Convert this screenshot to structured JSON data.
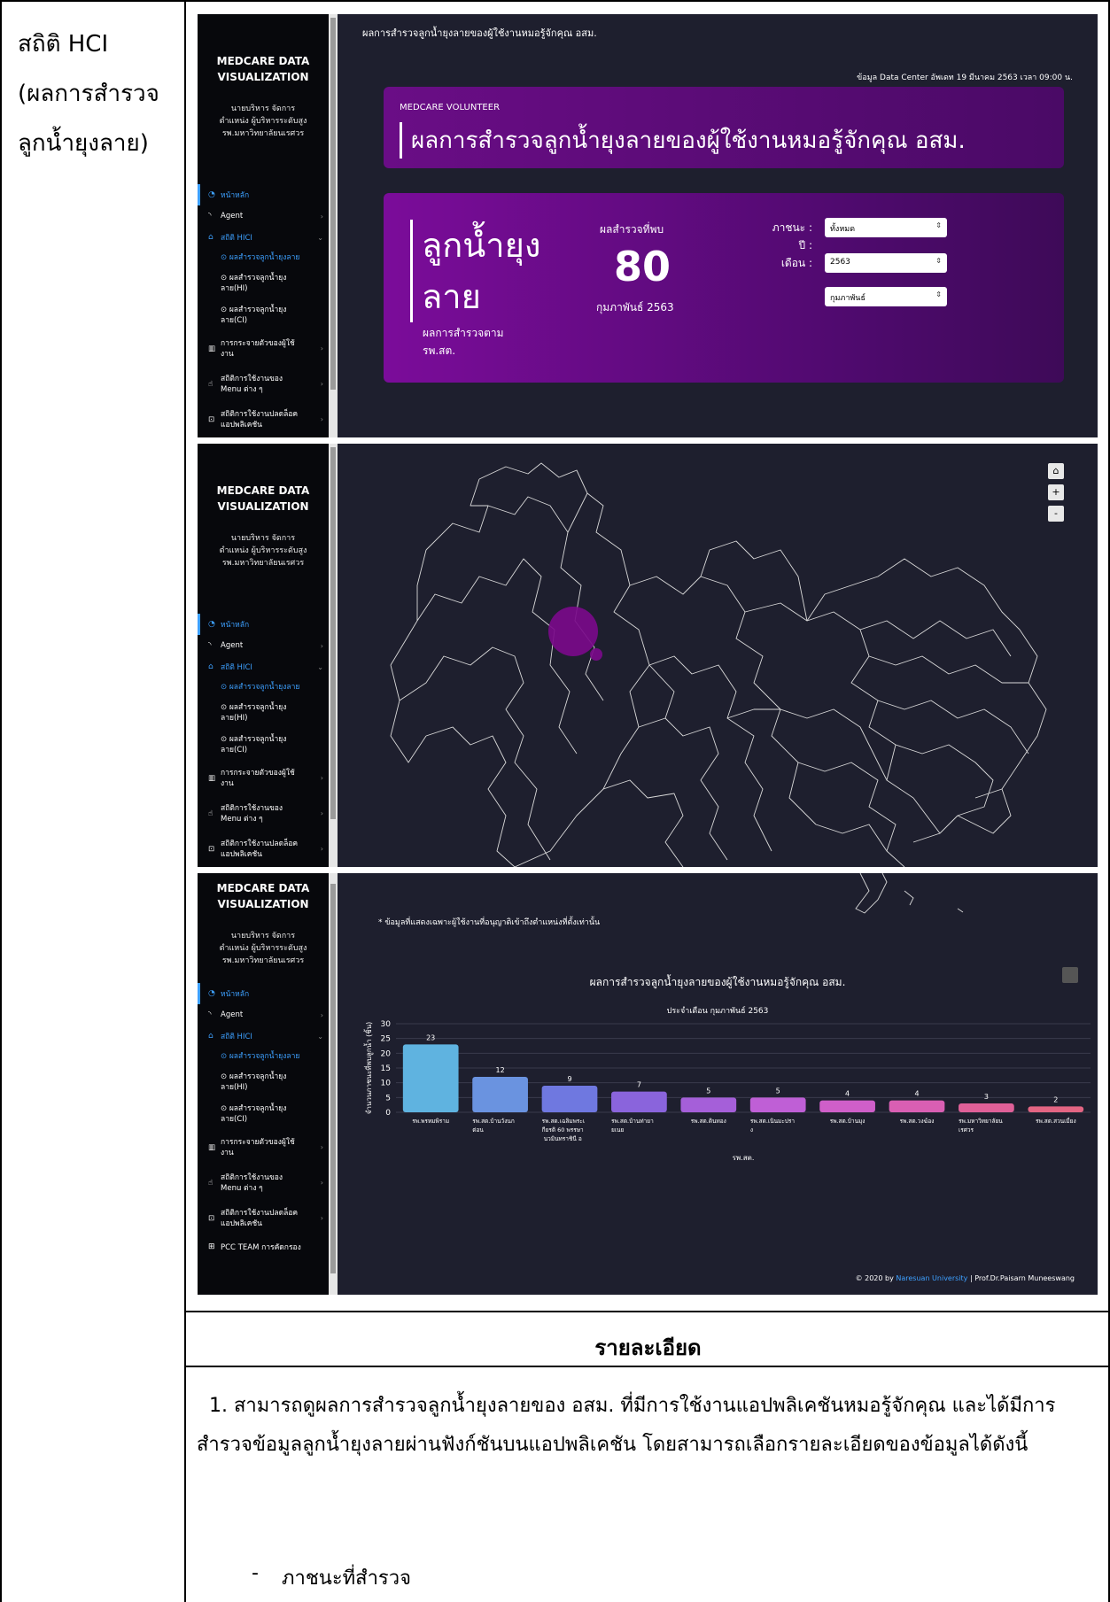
{
  "doc": {
    "row_label_line1": "สถิติ HCI",
    "row_label_line2": "(ผลการสำรวจ",
    "row_label_line3": "ลูกน้ำยุงลาย)",
    "detail_heading": "รายละเอียด",
    "detail_paragraph": "1. สามารถดูผลการสำรวจลูกน้ำยุงลายของ อสม. ที่มีการใช้งานแอปพลิเคชันหมอรู้จักคุณ และได้มีการสำรวจข้อมูลลูกน้ำยุงลายผ่านฟังก์ชันบนแอปพลิเคชัน โดยสามารถเลือกรายละเอียดของข้อมูลได้ดังนี้",
    "list_dash": "-",
    "list_item_1": "ภาชนะที่สำรวจ"
  },
  "sidebar": {
    "brand_line1": "MEDCARE DATA",
    "brand_line2": "VISUALIZATION",
    "user_line1": "นายบริหาร จัดการ",
    "user_line2": "ตำแหน่ง ผู้บริหารระดับสูง",
    "user_line3": "รพ.มหาวิทยาลัยนเรศวร",
    "home": "หน้าหลัก",
    "agent": "Agent",
    "hci": "สถิติ HICI",
    "sub1": "⊙ ผลสำรวจลูกน้ำยุงลาย",
    "sub2a": "⊙ ผลสำรวจลูกน้ำยุง",
    "sub2b": "ลาย(HI)",
    "sub3a": "⊙ ผลสำรวจลูกน้ำยุง",
    "sub3b": "ลาย(CI)",
    "dist_a": "การกระจายตัวของผู้ใช้",
    "dist_b": "งาน",
    "menu_a": "สถิติการใช้งานของ",
    "menu_b": "Menu ต่าง ๆ",
    "unlock_a": "สถิติการใช้งานปลดล็อค",
    "unlock_b": "แอปพลิเคชัน",
    "pcc": "PCC TEAM การคัดกรอง"
  },
  "panel1": {
    "top_title": "ผลการสำรวจลูกน้ำยุงลายของผู้ใช้งานหมอรู้จักคุณ อสม.",
    "data_source": "ข้อมูล Data Center อัพเดท 19 มีนาคม 2563 เวลา 09:00 น.",
    "kicker": "MEDCARE VOLUNTEER",
    "banner_title": "ผลการสำรวจลูกน้ำยุงลายของผู้ใช้งานหมอรู้จักคุณ อสม.",
    "big_title_1": "ลูกน้ำยุง",
    "big_title_2": "ลาย",
    "subtitle_1": "ผลการสำรวจตาม",
    "subtitle_2": "รพ.สต.",
    "stat_label": "ผลสำรวจที่พบ",
    "stat_value": "80",
    "stat_date": "กุมภาพันธ์ 2563",
    "filter_container_label": "ภาชนะ :",
    "filter_year_label": "ปี :",
    "filter_month_label": "เดือน :",
    "filter_container_value": "ทั้งหมด",
    "filter_year_value": "2563",
    "filter_month_value": "กุมภาพันธ์",
    "select_arrow": "⇕"
  },
  "panel2": {
    "home_btn": "⌂",
    "zoom_in": "+",
    "zoom_out": "-"
  },
  "panel3": {
    "note": "* ข้อมูลที่แสดงเฉพาะผู้ใช้งานที่อนุญาติเข้าถึงตำแหน่งที่ตั้งเท่านั้น",
    "footer_prefix": "© 2020 by",
    "footer_org": "Naresuan University",
    "footer_suffix": "| Prof.Dr.Paisarn Muneeswang"
  },
  "chart_data": {
    "type": "bar",
    "title": "ผลการสำรวจลูกน้ำยุงลายของผู้ใช้งานหมอรู้จักคุณ อสม.",
    "subtitle": "ประจำเดือน กุมภาพันธ์ 2563",
    "xlabel": "รพ.สต.",
    "ylabel": "จำนวนภาชนะที่พบลูกน้ำ (ชิ้น)",
    "ylim": [
      0,
      30
    ],
    "yticks": [
      0,
      5,
      10,
      15,
      20,
      25,
      30
    ],
    "categories": [
      "รพ.พรหมพิราม",
      "รพ.สต.บ้านวังนกต่อน",
      "รพ.สต.เฉลิมพระเกียรติ 60 พรรษา นวมินทราชินี อ.พิษณุโลก",
      "รพ.สต.บ้านท่ายายเนย",
      "รพ.สต.ดินทอง",
      "รพ.สต.เนินมะปราง",
      "รพ.สต.บ้านมุง",
      "รพ.สต.วงฆ้อง",
      "รพ.มหาวิทยาลัยนเรศวร",
      "รพ.สต.สวนเมี่ยง"
    ],
    "values": [
      23,
      12,
      9,
      7,
      5,
      5,
      4,
      4,
      3,
      2
    ],
    "colors": [
      "#5fb3e0",
      "#6a93e0",
      "#6f78e0",
      "#8a64dc",
      "#a55fd9",
      "#bf5fd6",
      "#cf5fc9",
      "#d95fb3",
      "#df6098",
      "#e36583"
    ],
    "grid": true
  }
}
